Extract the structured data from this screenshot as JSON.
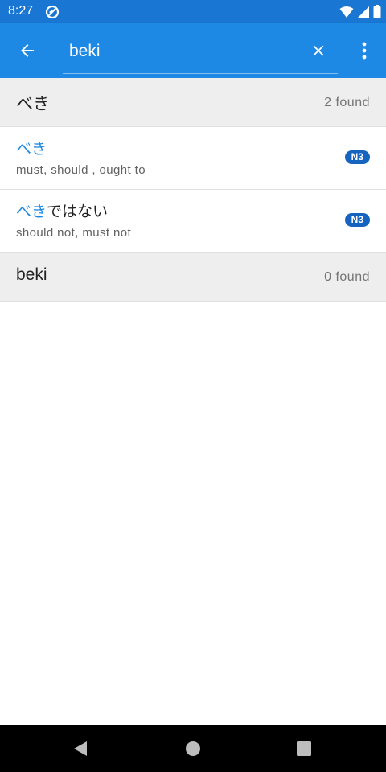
{
  "status": {
    "time": "8:27",
    "left_icon": "data-saver-icon",
    "icons": [
      "wifi-icon",
      "signal-icon",
      "battery-icon"
    ]
  },
  "colors": {
    "status_bar": "#1976D2",
    "app_bar": "#1E88E5",
    "accent": "#1E88E5",
    "badge": "#1565C0"
  },
  "app_bar": {
    "back_icon": "arrow-back-icon",
    "search": {
      "value": "beki",
      "placeholder": ""
    },
    "clear_icon": "close-icon",
    "more_icon": "more-vert-icon"
  },
  "sections": [
    {
      "title": "べき",
      "count": "2 found",
      "items": [
        {
          "highlight": "べき",
          "rest": "",
          "meaning": "must, should , ought to",
          "level": "N3"
        },
        {
          "highlight": "べき",
          "rest": "ではない",
          "meaning": "should not, must not",
          "level": "N3"
        }
      ]
    },
    {
      "title": "beki",
      "count": "0 found",
      "items": []
    }
  ],
  "nav": {
    "back": "nav-back-icon",
    "home": "nav-home-icon",
    "recents": "nav-recents-icon"
  }
}
